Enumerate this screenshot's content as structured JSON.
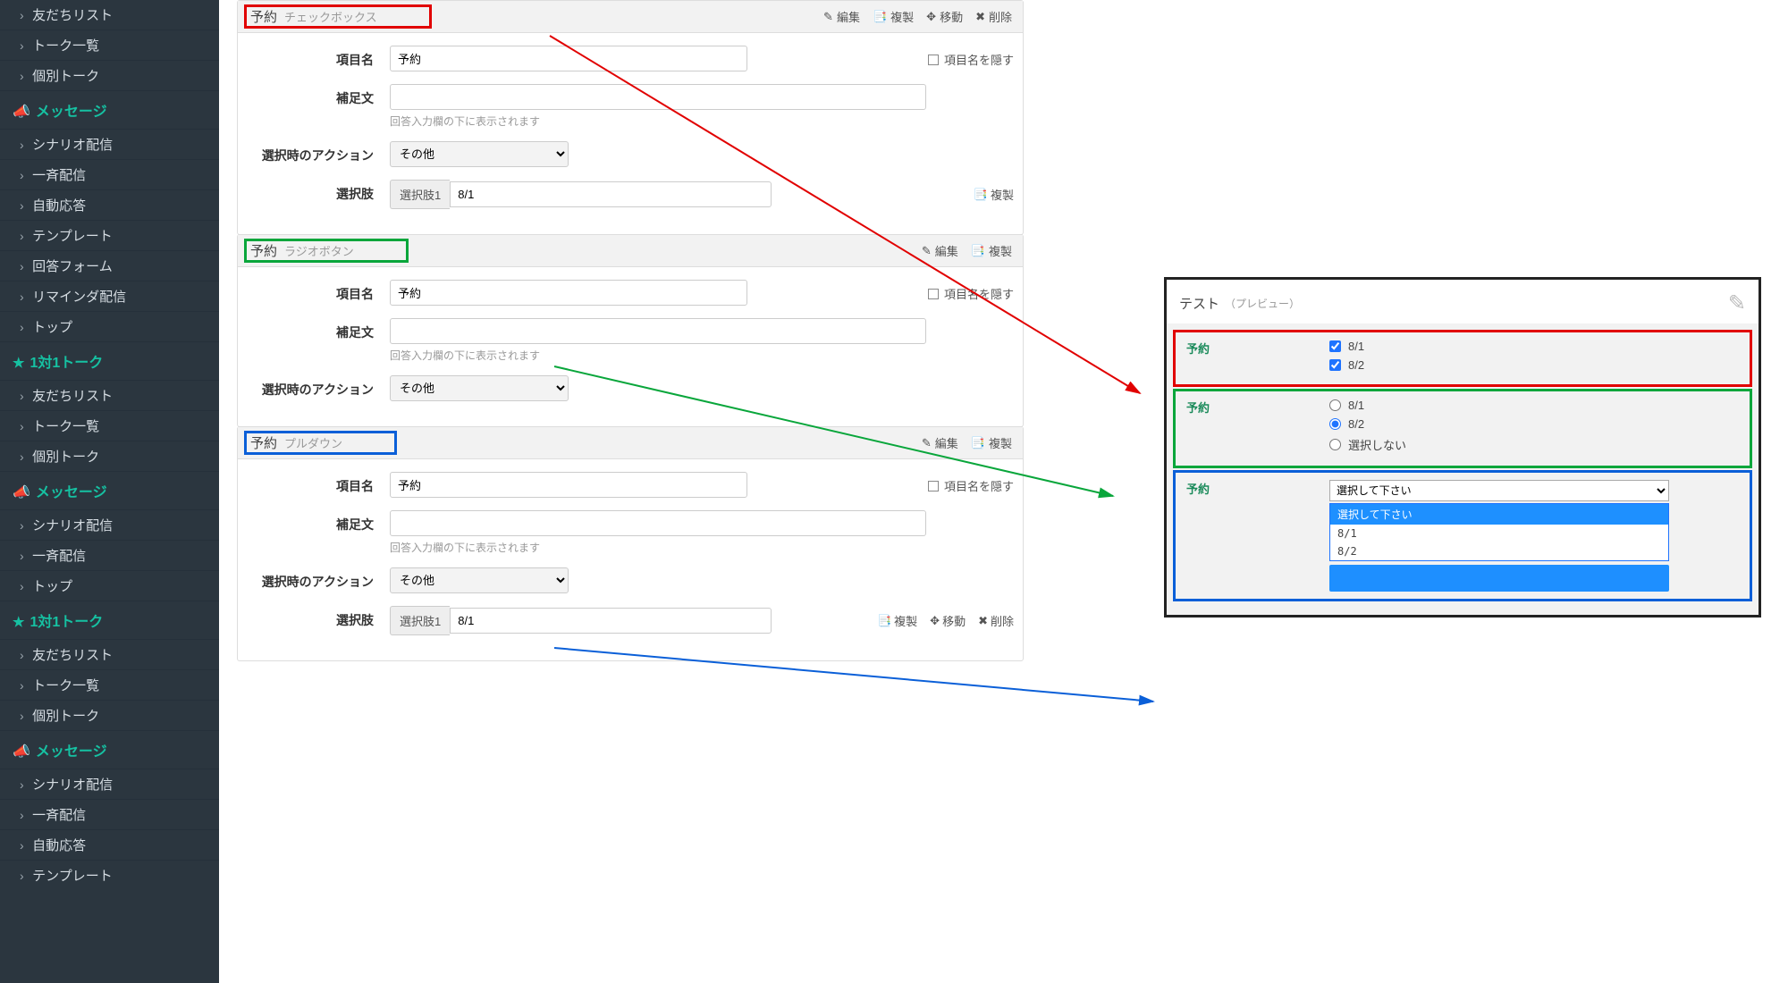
{
  "sidebar": {
    "groups": [
      {
        "items": [
          "友だちリスト",
          "トーク一覧",
          "個別トーク"
        ]
      },
      {
        "section": "メッセージ",
        "icon": "megaphone",
        "items": [
          "シナリオ配信",
          "一斉配信",
          "自動応答",
          "テンプレート",
          "回答フォーム",
          "リマインダ配信",
          "トップ"
        ]
      },
      {
        "section": "1対1トーク",
        "icon": "star",
        "items": [
          "友だちリスト",
          "トーク一覧",
          "個別トーク"
        ]
      },
      {
        "section": "メッセージ",
        "icon": "megaphone",
        "items": [
          "シナリオ配信",
          "一斉配信",
          "トップ"
        ]
      },
      {
        "section": "1対1トーク",
        "icon": "star",
        "items": [
          "友だちリスト",
          "トーク一覧",
          "個別トーク"
        ]
      },
      {
        "section": "メッセージ",
        "icon": "megaphone",
        "items": [
          "シナリオ配信",
          "一斉配信",
          "自動応答",
          "テンプレート"
        ]
      }
    ]
  },
  "actions": {
    "edit": "編集",
    "duplicate": "複製",
    "move": "移動",
    "delete": "削除"
  },
  "labels": {
    "item_name": "項目名",
    "supplement": "補足文",
    "on_select": "選択時のアクション",
    "choices": "選択肢",
    "hide_item_name": "項目名を隠す",
    "supplement_hint": "回答入力欄の下に表示されます",
    "choice_prefix": "選択肢1",
    "choice_value": "8/1",
    "action_other": "その他"
  },
  "panels": [
    {
      "title": "予約",
      "subtitle": "チェックボックス",
      "value": "予約",
      "color": "red"
    },
    {
      "title": "予約",
      "subtitle": "ラジオボタン",
      "value": "予約",
      "color": "green"
    },
    {
      "title": "予約",
      "subtitle": "プルダウン",
      "value": "予約",
      "color": "blue"
    }
  ],
  "preview": {
    "title": "テスト",
    "subtitle": "（プレビュー）",
    "sections": {
      "checkbox": {
        "label": "予約",
        "opts": [
          "8/1",
          "8/2"
        ],
        "checked": [
          true,
          true
        ]
      },
      "radio": {
        "label": "予約",
        "opts": [
          "8/1",
          "8/2",
          "選択しない"
        ],
        "selected": 1
      },
      "pulldown": {
        "label": "予約",
        "placeholder": "選択して下さい",
        "opts": [
          "選択して下さい",
          "8/1",
          "8/2"
        ]
      }
    }
  }
}
